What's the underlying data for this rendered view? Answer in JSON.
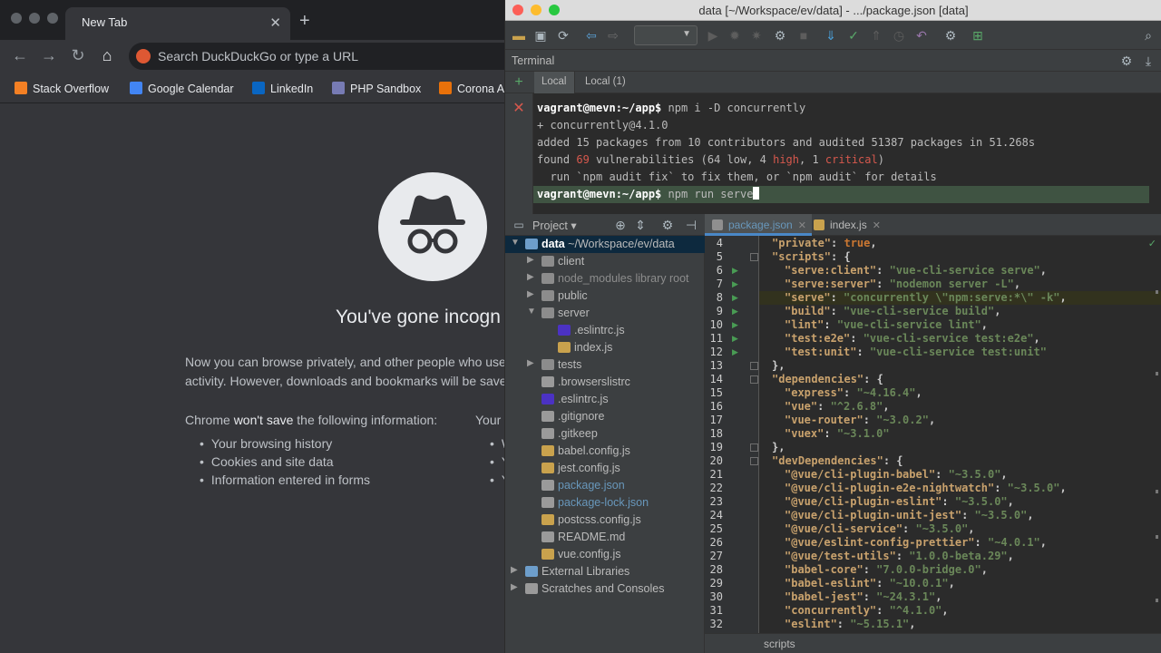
{
  "chrome": {
    "tab_title": "New Tab",
    "omnibox_placeholder": "Search DuckDuckGo or type a URL",
    "bookmarks": [
      {
        "label": "Stack Overflow",
        "icon": "stackoverflow-icon",
        "color": "#f48024"
      },
      {
        "label": "Google Calendar",
        "icon": "calendar-icon",
        "color": "#4285f4"
      },
      {
        "label": "LinkedIn",
        "icon": "linkedin-icon",
        "color": "#0a66c2"
      },
      {
        "label": "PHP Sandbox",
        "icon": "php-icon",
        "color": "#777bb4"
      },
      {
        "label": "Corona A",
        "icon": "corona-icon",
        "color": "#e8710a"
      }
    ],
    "headline": "You've gone incogn",
    "paragraph_1": "Now you can browse privately, and other people who use",
    "paragraph_2": "activity. However, downloads and bookmarks will be save",
    "wont_save_prefix": "Chrome ",
    "wont_save_bold": "won't save",
    "wont_save_suffix": " the following information:",
    "wont_save_items": [
      "Your browsing history",
      "Cookies and site data",
      "Information entered in forms"
    ],
    "col2_title": "Your",
    "col2_items": [
      "We",
      "Yo",
      "Yo"
    ]
  },
  "ide": {
    "window_title": "data [~/Workspace/ev/data] - .../package.json [data]",
    "terminal_label": "Terminal",
    "terminal_tabs": [
      "Local",
      "Local (1)"
    ],
    "terminal_lines": [
      {
        "prompt": "vagrant@mevn:~/app$",
        "text": " npm i -D concurrently"
      },
      {
        "text": "+ concurrently@4.1.0"
      },
      {
        "text": "added 15 packages from 10 contributors and audited 51387 packages in 51.268s"
      },
      {
        "pre": "found ",
        "n1": "69",
        "mid": " vulnerabilities (64 low, 4 ",
        "n2": "high",
        "mid2": ", 1 ",
        "n3": "critical",
        "post": ")"
      },
      {
        "text": "  run `npm audit fix` to fix them, or `npm audit` for details"
      },
      {
        "prompt": "vagrant@mevn:~/app$",
        "text": " npm run serve"
      }
    ],
    "project_label": "Project",
    "tree": [
      {
        "label": "data",
        "sub": "~/Workspace/ev/data",
        "indent": 0,
        "arrow": "down",
        "type": "folder-root"
      },
      {
        "label": "client",
        "indent": 1,
        "arrow": "right",
        "type": "folder"
      },
      {
        "label": "node_modules",
        "sub": "library root",
        "indent": 1,
        "arrow": "right",
        "type": "folder-lib"
      },
      {
        "label": "public",
        "indent": 1,
        "arrow": "right",
        "type": "folder"
      },
      {
        "label": "server",
        "indent": 1,
        "arrow": "down",
        "type": "folder"
      },
      {
        "label": ".eslintrc.js",
        "indent": 2,
        "type": "eslint"
      },
      {
        "label": "index.js",
        "indent": 2,
        "type": "js"
      },
      {
        "label": "tests",
        "indent": 1,
        "arrow": "right",
        "type": "folder"
      },
      {
        "label": ".browserslistrc",
        "indent": 1,
        "type": "text"
      },
      {
        "label": ".eslintrc.js",
        "indent": 1,
        "type": "eslint"
      },
      {
        "label": ".gitignore",
        "indent": 1,
        "type": "git"
      },
      {
        "label": ".gitkeep",
        "indent": 1,
        "type": "text"
      },
      {
        "label": "babel.config.js",
        "indent": 1,
        "type": "js"
      },
      {
        "label": "jest.config.js",
        "indent": 1,
        "type": "js"
      },
      {
        "label": "package.json",
        "indent": 1,
        "type": "json",
        "highlight": true
      },
      {
        "label": "package-lock.json",
        "indent": 1,
        "type": "json",
        "highlight": true
      },
      {
        "label": "postcss.config.js",
        "indent": 1,
        "type": "js"
      },
      {
        "label": "README.md",
        "indent": 1,
        "type": "md"
      },
      {
        "label": "vue.config.js",
        "indent": 1,
        "type": "js"
      },
      {
        "label": "External Libraries",
        "indent": 0,
        "arrow": "right",
        "type": "lib"
      },
      {
        "label": "Scratches and Consoles",
        "indent": 0,
        "arrow": "right",
        "type": "scratch"
      }
    ],
    "editor_tabs": [
      "package.json",
      "index.js"
    ],
    "code": [
      {
        "n": "4",
        "toks": [
          [
            "key",
            "\"private\""
          ],
          [
            "punc",
            ": "
          ],
          [
            "kw",
            "true"
          ],
          [
            "punc",
            ","
          ]
        ],
        "indent": 1
      },
      {
        "n": "5",
        "toks": [
          [
            "key",
            "\"scripts\""
          ],
          [
            "punc",
            ": {"
          ]
        ],
        "indent": 1,
        "fold": true
      },
      {
        "n": "6",
        "toks": [
          [
            "key",
            "\"serve:client\""
          ],
          [
            "punc",
            ": "
          ],
          [
            "str",
            "\"vue-cli-service serve\""
          ],
          [
            "punc",
            ","
          ]
        ],
        "indent": 2,
        "run": true
      },
      {
        "n": "7",
        "toks": [
          [
            "key",
            "\"serve:server\""
          ],
          [
            "punc",
            ": "
          ],
          [
            "str",
            "\"nodemon server -L\""
          ],
          [
            "punc",
            ","
          ]
        ],
        "indent": 2,
        "run": true
      },
      {
        "n": "8",
        "toks": [
          [
            "key",
            "\"serve\""
          ],
          [
            "punc",
            ": "
          ],
          [
            "str",
            "\"concurrently \\\"npm:serve:*\\\" -k\""
          ],
          [
            "punc",
            ","
          ]
        ],
        "indent": 2,
        "run": true,
        "current": true
      },
      {
        "n": "9",
        "toks": [
          [
            "key",
            "\"build\""
          ],
          [
            "punc",
            ": "
          ],
          [
            "str",
            "\"vue-cli-service build\""
          ],
          [
            "punc",
            ","
          ]
        ],
        "indent": 2,
        "run": true
      },
      {
        "n": "10",
        "toks": [
          [
            "key",
            "\"lint\""
          ],
          [
            "punc",
            ": "
          ],
          [
            "str",
            "\"vue-cli-service lint\""
          ],
          [
            "punc",
            ","
          ]
        ],
        "indent": 2,
        "run": true
      },
      {
        "n": "11",
        "toks": [
          [
            "key",
            "\"test:e2e\""
          ],
          [
            "punc",
            ": "
          ],
          [
            "str",
            "\"vue-cli-service test:e2e\""
          ],
          [
            "punc",
            ","
          ]
        ],
        "indent": 2,
        "run": true
      },
      {
        "n": "12",
        "toks": [
          [
            "key",
            "\"test:unit\""
          ],
          [
            "punc",
            ": "
          ],
          [
            "str",
            "\"vue-cli-service test:unit\""
          ]
        ],
        "indent": 2,
        "run": true
      },
      {
        "n": "13",
        "toks": [
          [
            "punc",
            "},"
          ]
        ],
        "indent": 1,
        "fold": true
      },
      {
        "n": "14",
        "toks": [
          [
            "key",
            "\"dependencies\""
          ],
          [
            "punc",
            ": {"
          ]
        ],
        "indent": 1,
        "fold": true
      },
      {
        "n": "15",
        "toks": [
          [
            "key",
            "\"express\""
          ],
          [
            "punc",
            ": "
          ],
          [
            "str",
            "\"~4.16.4\""
          ],
          [
            "punc",
            ","
          ]
        ],
        "indent": 2
      },
      {
        "n": "16",
        "toks": [
          [
            "key",
            "\"vue\""
          ],
          [
            "punc",
            ": "
          ],
          [
            "str",
            "\"^2.6.8\""
          ],
          [
            "punc",
            ","
          ]
        ],
        "indent": 2
      },
      {
        "n": "17",
        "toks": [
          [
            "key",
            "\"vue-router\""
          ],
          [
            "punc",
            ": "
          ],
          [
            "str",
            "\"~3.0.2\""
          ],
          [
            "punc",
            ","
          ]
        ],
        "indent": 2
      },
      {
        "n": "18",
        "toks": [
          [
            "key",
            "\"vuex\""
          ],
          [
            "punc",
            ": "
          ],
          [
            "str",
            "\"~3.1.0\""
          ]
        ],
        "indent": 2
      },
      {
        "n": "19",
        "toks": [
          [
            "punc",
            "},"
          ]
        ],
        "indent": 1,
        "fold": true
      },
      {
        "n": "20",
        "toks": [
          [
            "key",
            "\"devDependencies\""
          ],
          [
            "punc",
            ": {"
          ]
        ],
        "indent": 1,
        "fold": true
      },
      {
        "n": "21",
        "toks": [
          [
            "key",
            "\"@vue/cli-plugin-babel\""
          ],
          [
            "punc",
            ": "
          ],
          [
            "str",
            "\"~3.5.0\""
          ],
          [
            "punc",
            ","
          ]
        ],
        "indent": 2
      },
      {
        "n": "22",
        "toks": [
          [
            "key",
            "\"@vue/cli-plugin-e2e-nightwatch\""
          ],
          [
            "punc",
            ": "
          ],
          [
            "str",
            "\"~3.5.0\""
          ],
          [
            "punc",
            ","
          ]
        ],
        "indent": 2
      },
      {
        "n": "23",
        "toks": [
          [
            "key",
            "\"@vue/cli-plugin-eslint\""
          ],
          [
            "punc",
            ": "
          ],
          [
            "str",
            "\"~3.5.0\""
          ],
          [
            "punc",
            ","
          ]
        ],
        "indent": 2
      },
      {
        "n": "24",
        "toks": [
          [
            "key",
            "\"@vue/cli-plugin-unit-jest\""
          ],
          [
            "punc",
            ": "
          ],
          [
            "str",
            "\"~3.5.0\""
          ],
          [
            "punc",
            ","
          ]
        ],
        "indent": 2
      },
      {
        "n": "25",
        "toks": [
          [
            "key",
            "\"@vue/cli-service\""
          ],
          [
            "punc",
            ": "
          ],
          [
            "str",
            "\"~3.5.0\""
          ],
          [
            "punc",
            ","
          ]
        ],
        "indent": 2
      },
      {
        "n": "26",
        "toks": [
          [
            "key",
            "\"@vue/eslint-config-prettier\""
          ],
          [
            "punc",
            ": "
          ],
          [
            "str",
            "\"~4.0.1\""
          ],
          [
            "punc",
            ","
          ]
        ],
        "indent": 2
      },
      {
        "n": "27",
        "toks": [
          [
            "key",
            "\"@vue/test-utils\""
          ],
          [
            "punc",
            ": "
          ],
          [
            "str",
            "\"1.0.0-beta.29\""
          ],
          [
            "punc",
            ","
          ]
        ],
        "indent": 2
      },
      {
        "n": "28",
        "toks": [
          [
            "key",
            "\"babel-core\""
          ],
          [
            "punc",
            ": "
          ],
          [
            "str",
            "\"7.0.0-bridge.0\""
          ],
          [
            "punc",
            ","
          ]
        ],
        "indent": 2
      },
      {
        "n": "29",
        "toks": [
          [
            "key",
            "\"babel-eslint\""
          ],
          [
            "punc",
            ": "
          ],
          [
            "str",
            "\"~10.0.1\""
          ],
          [
            "punc",
            ","
          ]
        ],
        "indent": 2
      },
      {
        "n": "30",
        "toks": [
          [
            "key",
            "\"babel-jest\""
          ],
          [
            "punc",
            ": "
          ],
          [
            "str",
            "\"~24.3.1\""
          ],
          [
            "punc",
            ","
          ]
        ],
        "indent": 2
      },
      {
        "n": "31",
        "toks": [
          [
            "key",
            "\"concurrently\""
          ],
          [
            "punc",
            ": "
          ],
          [
            "str",
            "\"^4.1.0\""
          ],
          [
            "punc",
            ","
          ]
        ],
        "indent": 2
      },
      {
        "n": "32",
        "toks": [
          [
            "key",
            "\"eslint\""
          ],
          [
            "punc",
            ": "
          ],
          [
            "str",
            "\"~5.15.1\""
          ],
          [
            "punc",
            ","
          ]
        ],
        "indent": 2
      }
    ],
    "status_crumb": "scripts"
  }
}
